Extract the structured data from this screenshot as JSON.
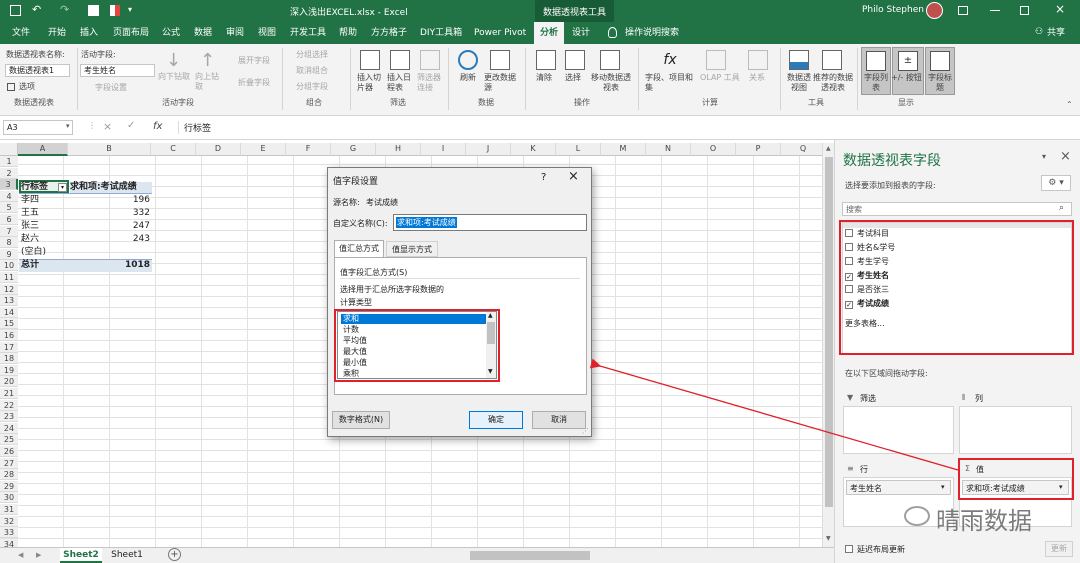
{
  "title_bar": {
    "filename": "深入浅出EXCEL.xlsx  -  Excel",
    "context_tool": "数据透视表工具",
    "user": "Philo Stephen"
  },
  "tabs": [
    "文件",
    "开始",
    "插入",
    "页面布局",
    "公式",
    "数据",
    "审阅",
    "视图",
    "开发工具",
    "帮助",
    "方方格子",
    "DIY工具箱",
    "Power Pivot",
    "分析",
    "设计",
    "操作说明搜索"
  ],
  "share": "共享",
  "ribbon": {
    "pt_name_label": "数据透视表名称:",
    "pt_name_value": "数据透视表1",
    "options": "选项",
    "group_pivot": "数据透视表",
    "active_field_label": "活动字段:",
    "active_field_value": "考生姓名",
    "field_settings": "字段设置",
    "drill_down": "向下钻取",
    "drill_up": "向上钻取",
    "expand_field": "展开字段",
    "collapse_field": "折叠字段",
    "group_active": "活动字段",
    "group_selection": "分组选择",
    "ungroup": "取消组合",
    "group_field": "分组字段",
    "group_group": "组合",
    "insert_slicer": "插入切片器",
    "insert_timeline": "插入日程表",
    "filter_connections": "筛选器连接",
    "group_filter": "筛选",
    "refresh": "刷新",
    "change_source": "更改数据源",
    "group_data": "数据",
    "clear": "清除",
    "select": "选择",
    "move_pivot": "移动数据透视表",
    "group_actions": "操作",
    "fields_items": "字段、项目和集",
    "olap_tools": "OLAP 工具",
    "relationships": "关系",
    "group_calc": "计算",
    "pivot_chart": "数据透视图",
    "recommended": "推荐的数据透视表",
    "group_tools": "工具",
    "field_list": "字段列表",
    "buttons_toggle": "+/- 按钮",
    "field_headers": "字段标题",
    "group_show": "显示"
  },
  "formula_bar": {
    "name_box": "A3",
    "fx": "fx",
    "content": "行标签"
  },
  "columns": [
    "A",
    "B",
    "C",
    "D",
    "E",
    "F",
    "G",
    "H",
    "I",
    "J",
    "K",
    "L",
    "M",
    "N",
    "O",
    "P",
    "Q"
  ],
  "rows": [
    "1",
    "2",
    "3",
    "4",
    "5",
    "6",
    "7",
    "8",
    "9",
    "10",
    "11",
    "12",
    "13",
    "14",
    "15",
    "16",
    "17",
    "18",
    "19",
    "20",
    "21",
    "22",
    "23",
    "24",
    "25",
    "26",
    "27",
    "28",
    "29",
    "30",
    "31",
    "32",
    "33",
    "34"
  ],
  "pivot": {
    "header_a": "行标签",
    "header_b": "求和项:考试成绩",
    "data": [
      {
        "name": "李四",
        "value": "196"
      },
      {
        "name": "王五",
        "value": "332"
      },
      {
        "name": "张三",
        "value": "247"
      },
      {
        "name": "赵六",
        "value": "243"
      },
      {
        "name": "(空白)",
        "value": ""
      }
    ],
    "total_label": "总计",
    "total_value": "1018"
  },
  "sheets": [
    "Sheet2",
    "Sheet1"
  ],
  "dialog": {
    "title": "值字段设置",
    "help": "?",
    "close": "×",
    "source_label": "源名称:",
    "source_value": "考试成绩",
    "custom_label": "自定义名称(C):",
    "custom_value": "求和项:考试成绩",
    "tab1": "值汇总方式",
    "tab2": "值显示方式",
    "summary_label": "值字段汇总方式(S)",
    "desc1": "选择用于汇总所选字段数据的",
    "desc2": "计算类型",
    "list": [
      "求和",
      "计数",
      "平均值",
      "最大值",
      "最小值",
      "乘积"
    ],
    "number_format": "数字格式(N)",
    "ok": "确定",
    "cancel": "取消"
  },
  "panel": {
    "title": "数据透视表字段",
    "subtitle": "选择要添加到报表的字段:",
    "search_placeholder": "搜索",
    "fields": [
      {
        "name": "考试科目",
        "checked": false
      },
      {
        "name": "姓名&学号",
        "checked": false
      },
      {
        "name": "考生学号",
        "checked": false
      },
      {
        "name": "考生姓名",
        "checked": true
      },
      {
        "name": "是否张三",
        "checked": false
      },
      {
        "name": "考试成绩",
        "checked": true
      }
    ],
    "more_tables": "更多表格...",
    "drag_hint": "在以下区域间拖动字段:",
    "filters": "筛选",
    "columns": "列",
    "rows": "行",
    "values": "值",
    "row_item": "考生姓名",
    "value_item": "求和项:考试成绩",
    "defer": "延迟布局更新",
    "update": "更新"
  },
  "watermark": "晴雨数据",
  "colors": {
    "excel_green": "#217346",
    "highlight_red": "#e0202a",
    "selection_blue": "#0078d7"
  }
}
